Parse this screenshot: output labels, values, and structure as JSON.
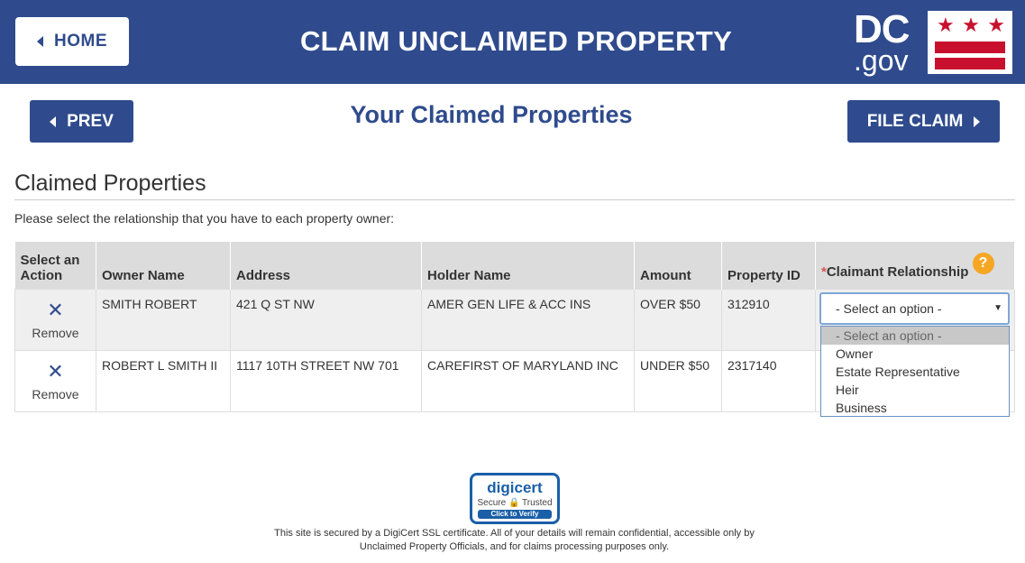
{
  "header": {
    "home_label": "HOME",
    "title": "CLAIM UNCLAIMED PROPERTY",
    "logo_dc": "DC",
    "logo_gov": ".gov"
  },
  "nav": {
    "prev_label": "PREV",
    "page_title": "Your Claimed Properties",
    "file_label": "FILE CLAIM"
  },
  "section": {
    "title": "Claimed Properties",
    "instruction": "Please select the relationship that you have to each property owner:"
  },
  "table": {
    "headers": {
      "action": "Select an Action",
      "owner": "Owner Name",
      "address": "Address",
      "holder": "Holder Name",
      "amount": "Amount",
      "property_id": "Property ID",
      "relationship_req": "*",
      "relationship": "Claimant Relationship"
    },
    "rows": [
      {
        "remove": "Remove",
        "owner": "SMITH ROBERT",
        "address": "421 Q ST NW",
        "holder": "AMER GEN LIFE & ACC INS",
        "amount": "OVER $50",
        "property_id": "312910"
      },
      {
        "remove": "Remove",
        "owner": "ROBERT L SMITH II",
        "address": "1117 10TH STREET NW 701",
        "holder": "CAREFIRST OF MARYLAND INC",
        "amount": "UNDER $50",
        "property_id": "2317140"
      }
    ]
  },
  "relationship_select": {
    "selected": "- Select an option -",
    "options": [
      "- Select an option -",
      "Owner",
      "Estate Representative",
      "Heir",
      "Business"
    ]
  },
  "footer": {
    "badge_brand": "digicert",
    "badge_secure": "Secure",
    "badge_trusted": "Trusted",
    "badge_verify": "Click to Verify",
    "text": "This site is secured by a DigiCert SSL certificate. All of your details will remain confidential, accessible only by Unclaimed Property Officials, and for claims processing purposes only."
  },
  "colors": {
    "brand_blue": "#2f4b8d",
    "flag_red": "#c8102e",
    "help_orange": "#f5a623"
  },
  "icons": [
    "chevron-left-icon",
    "chevron-right-icon",
    "remove-x-icon",
    "help-question-icon",
    "lock-icon",
    "dropdown-caret-icon"
  ]
}
